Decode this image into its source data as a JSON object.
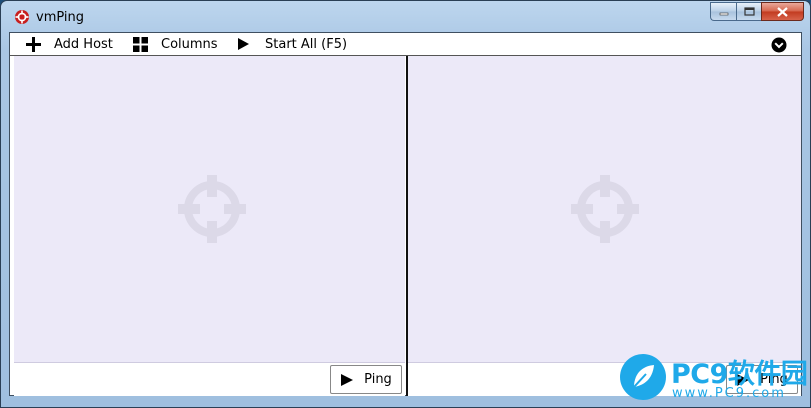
{
  "window": {
    "title": "vmPing",
    "icons": {
      "app": "crosshair-icon",
      "minimize": "minimize-icon",
      "maximize": "maximize-icon",
      "close": "close-icon"
    }
  },
  "toolbar": {
    "add_host": {
      "label": "Add Host",
      "icon": "plus-icon"
    },
    "columns": {
      "label": "Columns",
      "icon": "grid-icon"
    },
    "start_all": {
      "label": "Start All (F5)",
      "icon": "play-icon"
    },
    "overflow": {
      "icon": "chevron-down-circle-icon"
    }
  },
  "panels": [
    {
      "host_value": "",
      "ping_label": "Ping",
      "watermark_icon": "crosshair-icon"
    },
    {
      "host_value": "",
      "ping_label": "Ping",
      "watermark_icon": "crosshair-icon"
    }
  ],
  "watermark_logo": {
    "brand": "PC9软件园",
    "domain": "www.PC9.com"
  },
  "colors": {
    "display_bg": "#ece9f8",
    "logo_blue": "#1fa9e9",
    "close_red": "#c23a1f"
  }
}
